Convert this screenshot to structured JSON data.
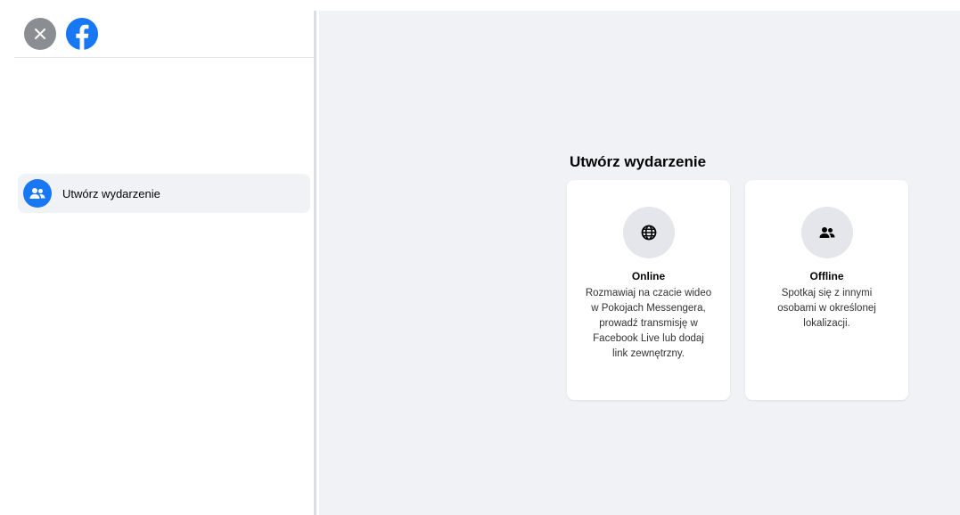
{
  "sidebar": {
    "close_icon": "close-icon",
    "logo_icon": "facebook-logo-icon",
    "items": [
      {
        "label": "Utwórz wydarzenie",
        "icon": "people-icon"
      }
    ]
  },
  "main": {
    "title": "Utwórz wydarzenie",
    "cards": [
      {
        "title": "Online",
        "description": "Rozmawiaj na czacie wideo w Pokojach Messengera, prowadź transmisję w Facebook Live lub dodaj link zewnętrzny.",
        "icon": "globe-icon"
      },
      {
        "title": "Offline",
        "description": "Spotkaj się z innymi osobami w określonej lokalizacji.",
        "icon": "people-icon"
      }
    ]
  },
  "colors": {
    "accent": "#1877f2",
    "background": "#f0f2f5",
    "icon_circle": "#e4e6eb",
    "close_button": "#8a8d91"
  }
}
